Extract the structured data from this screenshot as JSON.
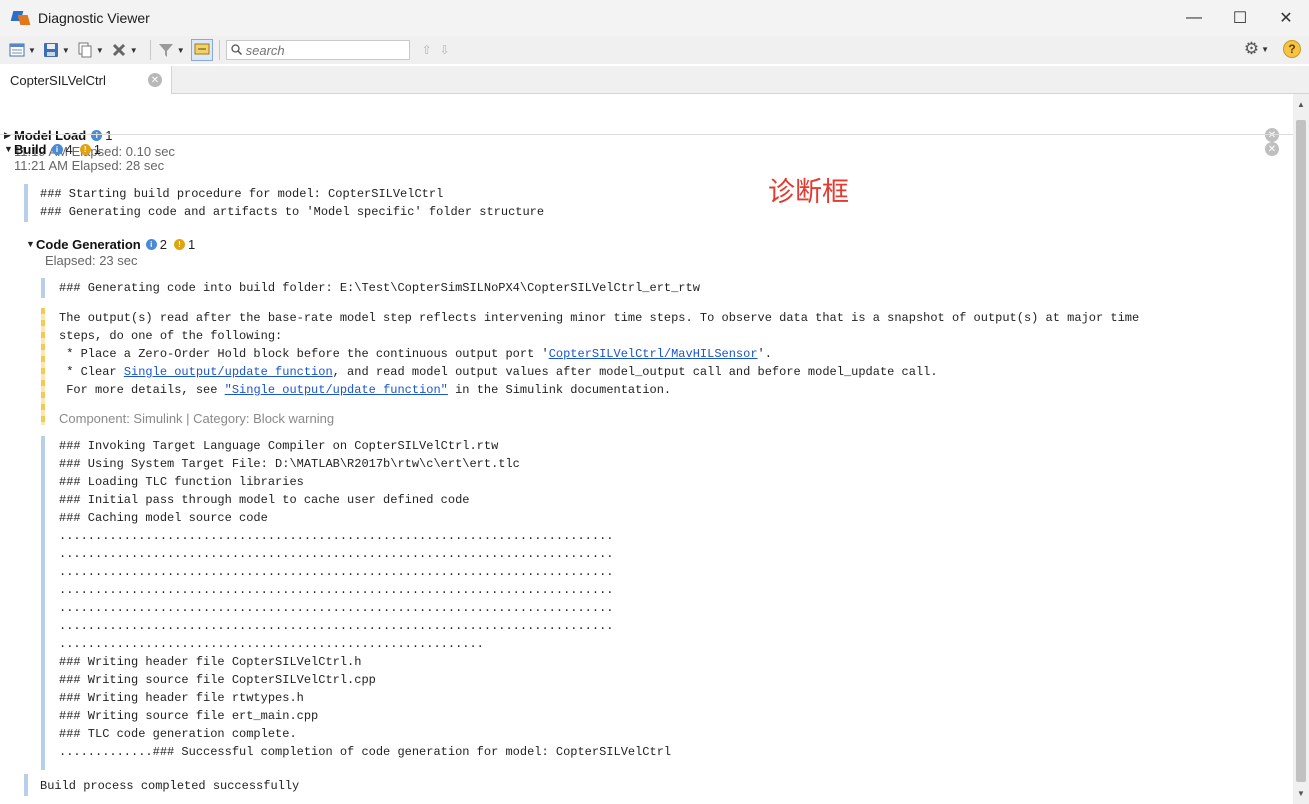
{
  "window": {
    "title": "Diagnostic Viewer",
    "controls": {
      "minimize": "—",
      "maximize": "☐",
      "close": "✕"
    }
  },
  "toolbar": {
    "search_placeholder": "search",
    "up_arrow": "⇧",
    "down_arrow": "⇩",
    "gear": "⚙",
    "help": "?"
  },
  "tab": {
    "label": "CopterSILVelCtrl",
    "close": "✕"
  },
  "annotation": "诊断框",
  "sections": {
    "model_load": {
      "title": "Model Load",
      "info_count": "1",
      "time": "11:19 AM  Elapsed: 0.10 sec"
    },
    "build": {
      "title": "Build",
      "info_count": "4",
      "warn_count": "1",
      "time": "11:21 AM  Elapsed: 28 sec",
      "message_1": "### Starting build procedure for model: CopterSILVelCtrl\n### Generating code and artifacts to 'Model specific' folder structure",
      "final_message": "Build process completed successfully"
    },
    "code_gen": {
      "title": "Code Generation",
      "info_count": "2",
      "warn_count": "1",
      "time": "Elapsed: 23 sec",
      "message_1": "### Generating code into build folder: E:\\Test\\CopterSimSILNoPX4\\CopterSILVelCtrl_ert_rtw",
      "warning": {
        "line_1": "The output(s) read after the base-rate model step reflects intervening minor time steps. To observe data that is a snapshot of output(s) at major time",
        "line_2": "steps, do one of the following:",
        "line_3_pre": " * Place a Zero-Order Hold block before the continuous output port '",
        "line_3_link": "CopterSILVelCtrl/MavHILSensor",
        "line_3_post": "'.",
        "line_4_pre": " * Clear ",
        "line_4_link": "Single output/update function",
        "line_4_post": ", and read model output values after model_output call and before model_update call.",
        "line_5_pre": " For more details, see ",
        "line_5_link": "\"Single output/update function\"",
        "line_5_post": " in the Simulink documentation.",
        "component": "Component: Simulink | Category: Block warning"
      },
      "tlc_log": "### Invoking Target Language Compiler on CopterSILVelCtrl.rtw\n### Using System Target File: D:\\MATLAB\\R2017b\\rtw\\c\\ert\\ert.tlc\n### Loading TLC function libraries\n### Initial pass through model to cache user defined code\n### Caching model source code\n.............................................................................\n.............................................................................\n.............................................................................\n.............................................................................\n.............................................................................\n.............................................................................\n...........................................................\n### Writing header file CopterSILVelCtrl.h\n### Writing source file CopterSILVelCtrl.cpp\n### Writing header file rtwtypes.h\n### Writing source file ert_main.cpp\n### TLC code generation complete.\n.............### Successful completion of code generation for model: CopterSILVelCtrl"
    }
  }
}
